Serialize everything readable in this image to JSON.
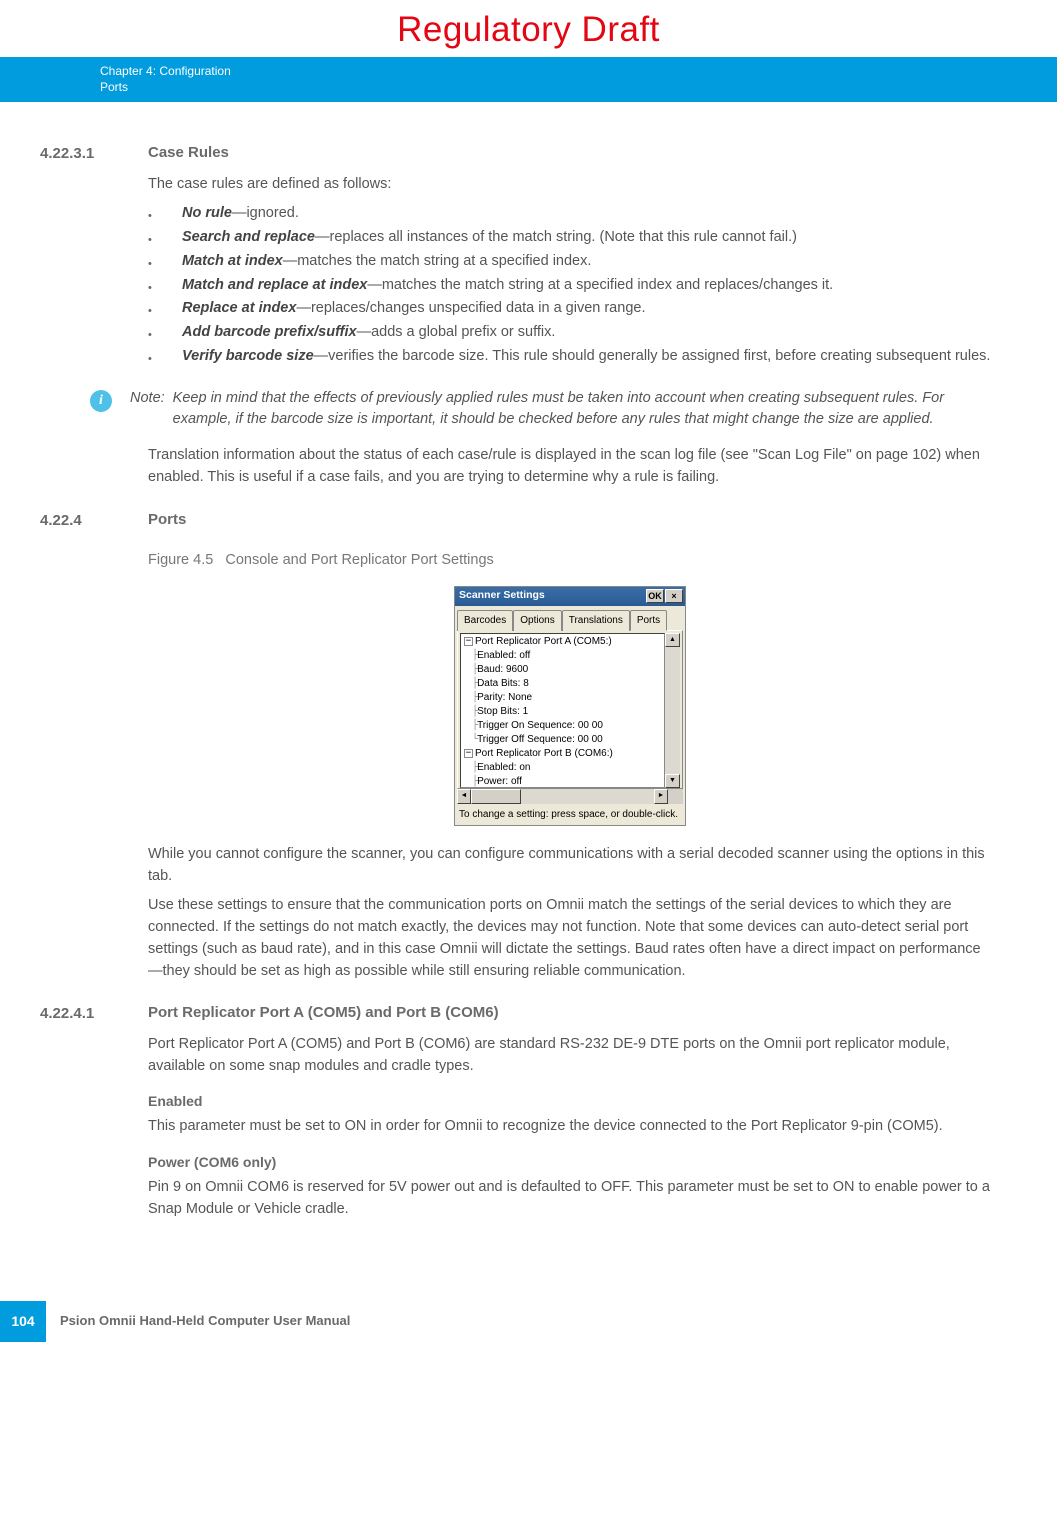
{
  "watermark": "Regulatory Draft",
  "header": {
    "chapter": "Chapter 4:",
    "title_suffix": "Configuration",
    "sub": "Ports"
  },
  "s1": {
    "num": "4.22.3.1",
    "title": "Case Rules",
    "intro": "The case rules are defined as follows:",
    "items": [
      {
        "b": "No rule",
        "t": "—ignored."
      },
      {
        "b": "Search and replace",
        "t": "—replaces all instances of the match string. (Note that this rule cannot fail.)"
      },
      {
        "b": "Match at index",
        "t": "—matches the match string at a specified index."
      },
      {
        "b": "Match and replace at index",
        "t": "—matches the match string at a specified index and replaces/changes it."
      },
      {
        "b": "Replace at index",
        "t": "—replaces/changes unspecified data in a given range."
      },
      {
        "b": "Add barcode prefix/suffix",
        "t": "—adds a global prefix or suffix."
      },
      {
        "b": "Verify barcode size",
        "t": "—verifies the barcode size. This rule should generally be assigned first, before creating subsequent rules."
      }
    ],
    "note_label": "Note:",
    "note_text": "Keep in mind that the effects of previously applied rules must be taken into account when creating subsequent rules. For example, if the barcode size is important, it should be checked before any rules that might change the size are applied.",
    "after": "Translation information about the status of each case/rule is displayed in the scan log file (see \"Scan Log File\" on page 102) when enabled. This is useful if a case fails, and you are trying to determine why a rule is failing."
  },
  "s2": {
    "num": "4.22.4",
    "title": "Ports",
    "fig_prefix": "Figure 4.5",
    "fig_caption": "Console and Port Replicator Port Settings",
    "ss": {
      "title": "Scanner Settings",
      "ok": "OK",
      "close": "×",
      "tabs": [
        "Barcodes",
        "Options",
        "Translations",
        "Ports"
      ],
      "tree": [
        "Port Replicator Port A (COM5:)",
        "Enabled: off",
        "Baud: 9600",
        "Data Bits: 8",
        "Parity: None",
        "Stop Bits: 1",
        "Trigger On Sequence: 00 00",
        "Trigger Off Sequence: 00 00",
        "Port Replicator Port B (COM6:)",
        "Enabled: on",
        "Power: off"
      ],
      "hint": "To change a setting: press space, or double-click."
    },
    "p1": "While you cannot configure the scanner, you can configure communications with a serial decoded scanner using the options in this tab.",
    "p2": "Use these settings to ensure that the communication ports on Omnii match the settings of the serial devices to which they are connected. If the settings do not match exactly, the devices may not function. Note that some devices can auto-detect serial port settings (such as baud rate), and in this case Omnii will dictate the settings. Baud rates often have a direct impact on performance—they should be set as high as possible while still ensuring reliable communication."
  },
  "s3": {
    "num": "4.22.4.1",
    "title": "Port Replicator Port A (COM5) and Port B (COM6)",
    "p1": "Port Replicator Port A (COM5) and Port B (COM6) are standard RS-232 DE-9 DTE ports on the Omnii port replicator module, available on some snap modules and cradle types.",
    "h_enabled": "Enabled",
    "p_enabled": "This parameter must be set to ON in order for Omnii to recognize the device connected to the Port Replicator 9-pin (COM5).",
    "h_power": "Power (COM6 only)",
    "p_power": "Pin 9 on Omnii COM6 is reserved for 5V power out and is defaulted to OFF. This parameter must be set to ON to enable power to a Snap Module or Vehicle cradle."
  },
  "footer": {
    "page": "104",
    "text": "Psion Omnii Hand-Held Computer User Manual"
  }
}
